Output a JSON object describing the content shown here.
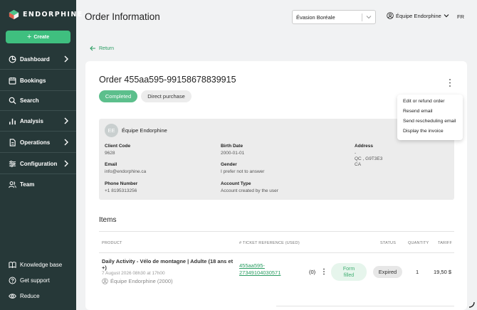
{
  "brand": {
    "name": "ENDORPHINE",
    "accent": "#3fbf7f",
    "sidebar_bg": "#263838"
  },
  "sidebar": {
    "create_label": "Create",
    "items": [
      {
        "label": "Dashboard",
        "icon": "dashboard-icon",
        "has_submenu": true
      },
      {
        "label": "Bookings",
        "icon": "calendar-icon",
        "has_submenu": false
      },
      {
        "label": "Search",
        "icon": "search-icon",
        "has_submenu": false
      },
      {
        "label": "Analysis",
        "icon": "bar-chart-icon",
        "has_submenu": true
      },
      {
        "label": "Operations",
        "icon": "document-icon",
        "has_submenu": true
      },
      {
        "label": "Configuration",
        "icon": "sliders-icon",
        "has_submenu": true
      },
      {
        "label": "Team",
        "icon": "team-icon",
        "has_submenu": false
      }
    ],
    "bottom_items": [
      {
        "label": "Knowledge base",
        "icon": "book-icon"
      },
      {
        "label": "Get support",
        "icon": "help-icon"
      },
      {
        "label": "Reduce",
        "icon": "eye-icon"
      }
    ]
  },
  "header": {
    "title": "Order Information",
    "org_select_value": "Évasion Boréale",
    "user_label": "Équipe Endorphine",
    "lang": "FR"
  },
  "return_label": "Return",
  "order": {
    "title": "Order 455aa595-99158678839915",
    "status": "Completed",
    "type": "Direct purchase",
    "menu": [
      "Edit or refund order",
      "Resend email",
      "Send rescheduling email",
      "Display the invoice"
    ]
  },
  "client": {
    "initials": "EE",
    "name": "Équipe Endorphine",
    "fields": {
      "client_code_label": "Client Code",
      "client_code": "9628",
      "email_label": "Email",
      "email": "info@endorphine.ca",
      "phone_label": "Phone Number",
      "phone": "+1 8195313256",
      "birth_label": "Birth Date",
      "birth": "2000-01-01",
      "gender_label": "Gender",
      "gender": "I prefer not to answer",
      "account_type_label": "Account Type",
      "account_type": "Account created by the user",
      "address_label": "Address",
      "address_line1": "-",
      "address_line2": "QC , G9T3E3",
      "address_line3": "CA"
    }
  },
  "items": {
    "title": "Items",
    "columns": {
      "product": "PRODUCT",
      "ticket": "# TICKET REFERENCE (USED)",
      "status": "STATUS",
      "quantity": "QUANTITY",
      "tariff": "TARIFF"
    },
    "rows": [
      {
        "product": "Daily Activity - Vélo de montagne | Adulte (18 ans et +)",
        "date": "7 August 2026 08h30 at 17h00",
        "owner": "Équipe Endorphine (2000)",
        "ticket_line1": "455aa595-",
        "ticket_line2": "27349104030571",
        "ticket_count": "(0)",
        "form_line1": "Form",
        "form_line2": "filled",
        "status": "Expired",
        "quantity": "1",
        "tariff": "19,50 $"
      }
    ]
  }
}
